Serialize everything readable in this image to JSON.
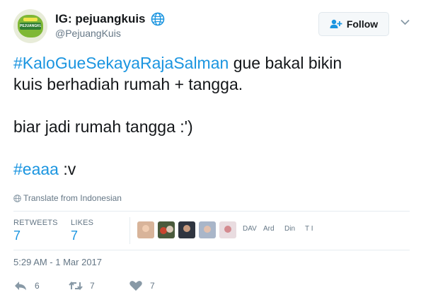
{
  "colors": {
    "link": "#1b95e0",
    "muted": "#657786",
    "text": "#14171a",
    "border": "#e6ecf0"
  },
  "user": {
    "display_name": "IG: pejuangkuis",
    "screen_name": "@PejuangKuis",
    "avatar_text": "PEJUANGKUIS"
  },
  "follow": {
    "label": "Follow",
    "icon": "add-user-icon"
  },
  "tweet": {
    "hashtag1": "#KaloGueSekayaRajaSalman",
    "line1_rest": " gue bakal bikin",
    "line2": "kuis berhadiah rumah + tangga.",
    "line3": "biar jadi rumah tangga :')",
    "hashtag2": "#eaaa",
    "line4_rest": " :v"
  },
  "translate": {
    "label": "Translate from Indonesian",
    "icon": "globe-icon"
  },
  "stats": {
    "retweets_label": "RETWEETS",
    "retweets_value": "7",
    "likes_label": "LIKES",
    "likes_value": "7"
  },
  "likers": {
    "names": [
      "DAV",
      "Ard",
      "Din",
      "T I"
    ]
  },
  "timestamp": "5:29 AM - 1 Mar 2017",
  "actions": {
    "reply_count": "6",
    "retweet_count": "7",
    "like_count": "7"
  }
}
